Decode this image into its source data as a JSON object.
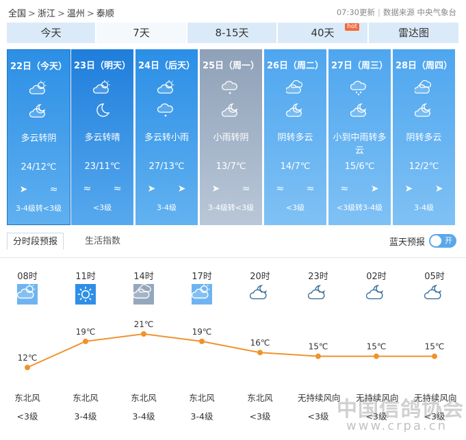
{
  "breadcrumb": [
    "全国",
    "浙江",
    "温州",
    "泰顺"
  ],
  "source": {
    "updated": "07:30更新",
    "label": "数据来源 中央气象台"
  },
  "tabs": [
    {
      "label": "今天"
    },
    {
      "label": "7天",
      "active": true
    },
    {
      "label": "8-15天"
    },
    {
      "label": "40天",
      "badge": "hot"
    },
    {
      "label": "雷达图"
    }
  ],
  "days": [
    {
      "date": "22日（今天）",
      "icon_day": "partly-cloudy-icon",
      "icon_night": "cloudy-night-icon",
      "desc": "多云转阴",
      "temp": "24/12℃",
      "wind": "➤ ≈",
      "level": "3-4级转<3级"
    },
    {
      "date": "23日（明天）",
      "icon_day": "partly-cloudy-icon",
      "icon_night": "clear-night-icon",
      "desc": "多云转晴",
      "temp": "23/11℃",
      "wind": "≈ ≈",
      "level": "<3级"
    },
    {
      "date": "24日（后天）",
      "icon_day": "partly-cloudy-icon",
      "icon_night": "light-rain-icon",
      "desc": "多云转小雨",
      "temp": "27/13℃",
      "wind": "➤ ➤",
      "level": "3-4级"
    },
    {
      "date": "25日（周一）",
      "icon_day": "light-rain-icon",
      "icon_night": "cloudy-night-icon",
      "desc": "小雨转阴",
      "temp": "13/7℃",
      "wind": "➤ ≈",
      "level": "3-4级转<3级"
    },
    {
      "date": "26日（周二）",
      "icon_day": "overcast-icon",
      "icon_night": "cloudy-night-icon",
      "desc": "阴转多云",
      "temp": "14/7℃",
      "wind": "≈ ≈",
      "level": "<3级"
    },
    {
      "date": "27日（周三）",
      "icon_day": "moderate-rain-icon",
      "icon_night": "cloudy-night-icon",
      "desc": "小到中雨转多云",
      "temp": "15/6℃",
      "wind": "≈ ➤",
      "level": "<3级转3-4级"
    },
    {
      "date": "28日（周四）",
      "icon_day": "overcast-icon",
      "icon_night": "cloudy-night-icon",
      "desc": "阴转多云",
      "temp": "12/2℃",
      "wind": "➤ ➤",
      "level": "3-4级"
    }
  ],
  "subtabs": [
    {
      "label": "分时段预报",
      "active": true
    },
    {
      "label": "生活指数"
    }
  ],
  "toggle": {
    "label": "蓝天预报",
    "state": "开"
  },
  "hourly": [
    {
      "hour": "08时",
      "icon": "partly-cloudy-icon",
      "temp_c": 12,
      "temp": "12℃",
      "wind_dir": "东北风",
      "wind_level": "<3级"
    },
    {
      "hour": "11时",
      "icon": "sunny-icon",
      "temp_c": 19,
      "temp": "19℃",
      "wind_dir": "东北风",
      "wind_level": "3-4级"
    },
    {
      "hour": "14时",
      "icon": "overcast-icon",
      "temp_c": 21,
      "temp": "21℃",
      "wind_dir": "东北风",
      "wind_level": "3-4级"
    },
    {
      "hour": "17时",
      "icon": "partly-cloudy-icon",
      "temp_c": 19,
      "temp": "19℃",
      "wind_dir": "东北风",
      "wind_level": "3-4级"
    },
    {
      "hour": "20时",
      "icon": "cloudy-night-icon",
      "temp_c": 16,
      "temp": "16℃",
      "wind_dir": "东北风",
      "wind_level": "<3级"
    },
    {
      "hour": "23时",
      "icon": "cloudy-night-icon",
      "temp_c": 15,
      "temp": "15℃",
      "wind_dir": "无持续风向",
      "wind_level": "<3级"
    },
    {
      "hour": "02时",
      "icon": "cloudy-night-icon",
      "temp_c": 15,
      "temp": "15℃",
      "wind_dir": "无持续风向",
      "wind_level": "<3级"
    },
    {
      "hour": "05时",
      "icon": "cloudy-night-icon",
      "temp_c": 15,
      "temp": "15℃",
      "wind_dir": "无持续风向",
      "wind_level": "<3级"
    }
  ],
  "watermark": {
    "text": "中国信鸽协会",
    "url": "www.crpa.cn"
  },
  "colors": {
    "accent": "#2c8fe5",
    "curve": "#f0922c",
    "tab": "#dbeaf8"
  }
}
